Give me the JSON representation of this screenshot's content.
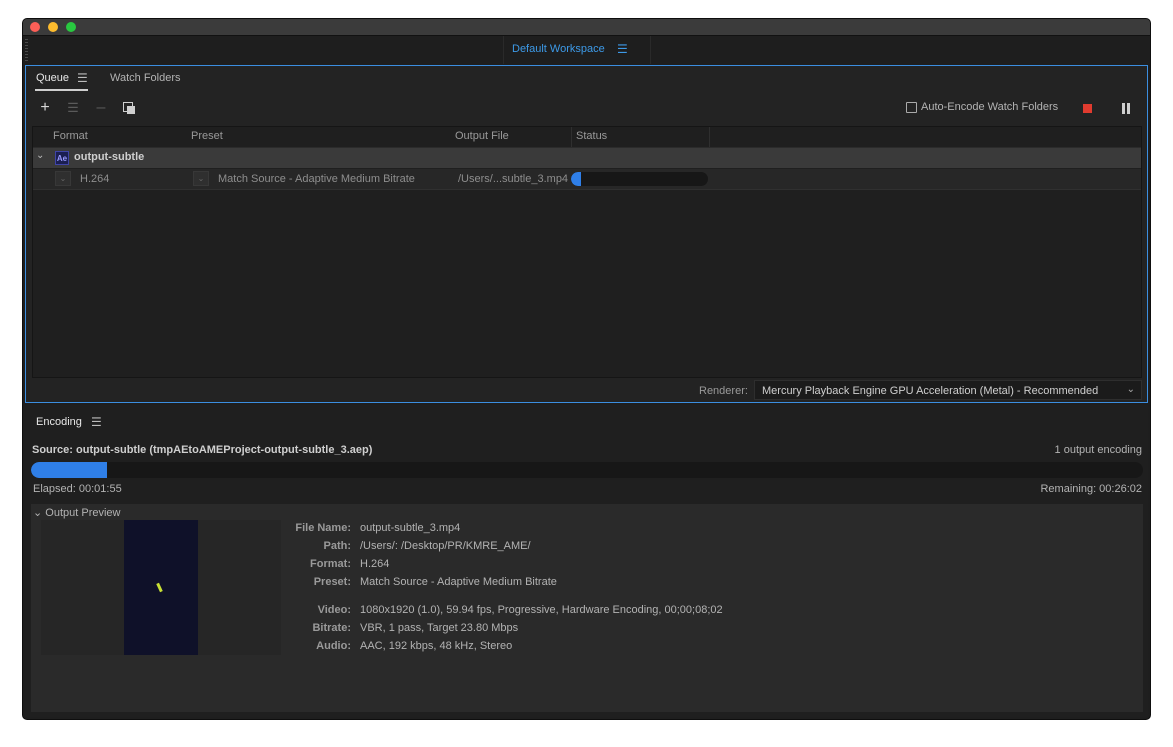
{
  "workspace": {
    "label": "Default Workspace",
    "menu_icon": "hamburger-icon"
  },
  "queue": {
    "tabs": [
      {
        "label": "Queue"
      },
      {
        "label": "Watch Folders"
      }
    ],
    "toolbar": {
      "auto_encode_label": "Auto-Encode Watch Folders"
    },
    "columns": [
      "Format",
      "Preset",
      "Output File",
      "Status"
    ],
    "group": {
      "name": "output-subtle",
      "badge": "Ae"
    },
    "item": {
      "format": "H.264",
      "preset": "Match Source - Adaptive Medium Bitrate",
      "output_file": "/Users/...subtle_3.mp4",
      "status_progress": 0.07
    },
    "renderer": {
      "label": "Renderer:",
      "value": "Mercury Playback Engine GPU Acceleration (Metal) - Recommended"
    }
  },
  "encoding": {
    "tab_label": "Encoding",
    "source": "Source: output-subtle (tmpAEtoAMEProject-output-subtle_3.aep)",
    "output_count": "1 output encoding",
    "progress": 0.068,
    "elapsed": "Elapsed: 00:01:55",
    "remaining": "Remaining: 00:26:02",
    "preview_label": "Output Preview",
    "details": [
      {
        "key": "File Name:",
        "value": "output-subtle_3.mp4"
      },
      {
        "key": "Path:",
        "value": "/Users/:                        /Desktop/PR/KMRE_AME/"
      },
      {
        "key": "Format:",
        "value": "H.264"
      },
      {
        "key": "Preset:",
        "value": "Match Source - Adaptive Medium Bitrate"
      },
      {
        "key": "Video:",
        "value": "1080x1920 (1.0), 59.94 fps, Progressive, Hardware Encoding, 00;00;08;02"
      },
      {
        "key": "Bitrate:",
        "value": "VBR, 1 pass, Target 23.80 Mbps"
      },
      {
        "key": "Audio:",
        "value": "AAC, 192 kbps, 48 kHz, Stereo"
      }
    ]
  },
  "colors": {
    "accent": "#2f7fe8",
    "stop": "#e03b2f",
    "workspace_text": "#3d9ae8"
  }
}
